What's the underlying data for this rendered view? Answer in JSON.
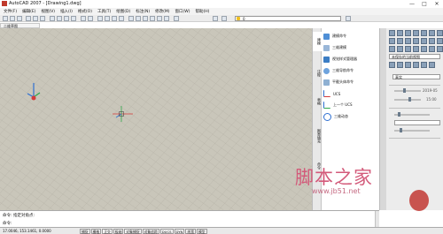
{
  "window": {
    "title": "AutoCAD 2007 - [Drawing1.dwg]",
    "minimize_glyph": "—",
    "maximize_glyph": "□",
    "close_glyph": "✕"
  },
  "menu": [
    "文件(F)",
    "编辑(E)",
    "视图(V)",
    "插入(I)",
    "格式(O)",
    "工具(T)",
    "绘图(D)",
    "标注(N)",
    "修改(M)",
    "窗口(W)",
    "帮助(H)"
  ],
  "toolbar": {
    "layer_value": "0",
    "icons": [
      "new-icon",
      "open-icon",
      "save-icon",
      "print-icon",
      "preview-icon",
      "publish-icon",
      "cut-icon",
      "copy-icon",
      "paste-icon",
      "match-icon",
      "undo-icon",
      "redo-icon",
      "pan-icon",
      "zoom-icon",
      "zoom-window-icon",
      "zoom-previous-icon",
      "properties-icon",
      "designcenter-icon",
      "toolpalette-icon",
      "sheetset-icon",
      "markup-icon",
      "calc-icon",
      "help-icon"
    ]
  },
  "viewport": {
    "tab_label": "二维草图"
  },
  "palette": {
    "tabs": [
      "建模",
      "注释",
      "表格",
      "图案填充",
      "命令"
    ],
    "items": [
      {
        "label": "建模命令",
        "icon": "blue-cube-icon"
      },
      {
        "label": "三维建模",
        "icon": "pyramid-icon"
      },
      {
        "label": "视觉样式管理器",
        "icon": "blue-box-icon"
      },
      {
        "label": "三维导航命令",
        "icon": "torus-icon"
      },
      {
        "label": "平截头体命令",
        "icon": "wedge-icon"
      },
      {
        "label": "UCS",
        "icon": "ucs-icon"
      },
      {
        "label": "上一个 UCS",
        "icon": "ucs-previous-icon"
      },
      {
        "label": "三维动态",
        "icon": "orbit-icon"
      }
    ]
  },
  "dashboard": {
    "visual_style": "真实",
    "view_label": "未保存的当前视图",
    "date_label": "2019-05",
    "time_label": "15:00"
  },
  "command": {
    "line1": "命令: 指定对角点:",
    "line2": "命令:"
  },
  "status": {
    "coordinates": "17.0046, 153.1461, 0.0000",
    "buttons": [
      "捕捉",
      "栅格",
      "正交",
      "极轴",
      "对象捕捉",
      "对象追踪",
      "DUCS",
      "DYN",
      "线宽",
      "模型"
    ]
  },
  "watermark": {
    "text": "脚本之家",
    "url": "www.jb51.net"
  },
  "colors": {
    "drawing_bg": "#c9c6ba",
    "grid_line": "#b6b3a7",
    "axis_x": "#d43a3a",
    "axis_y": "#2fa84a",
    "axis_z": "#2e6fd1"
  }
}
